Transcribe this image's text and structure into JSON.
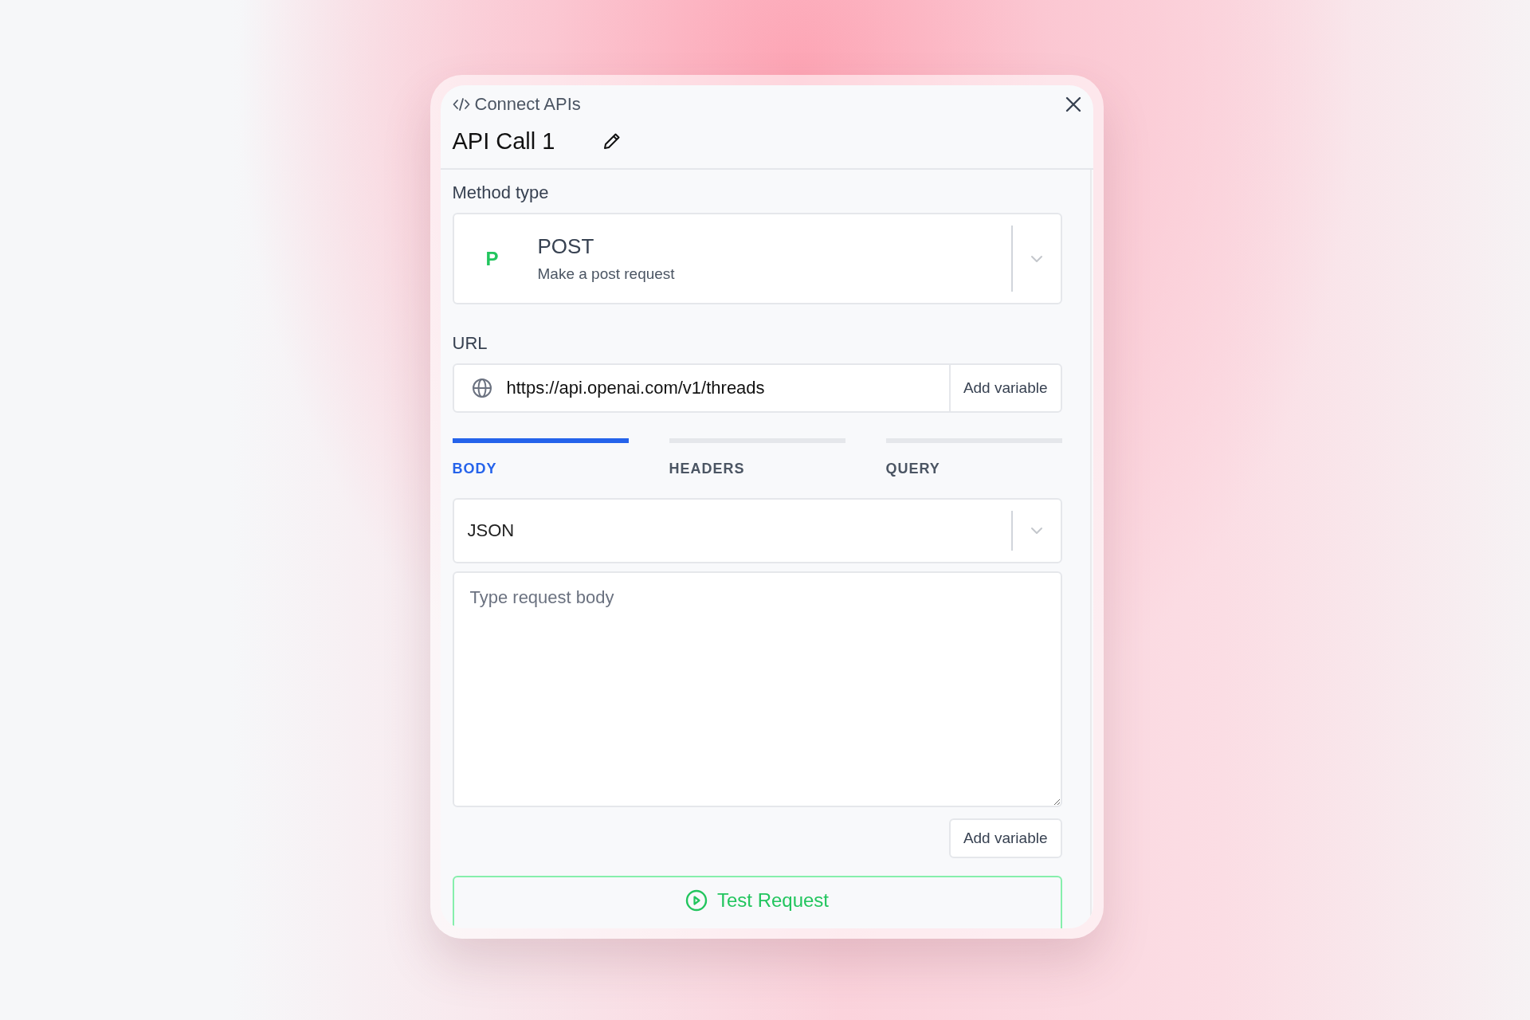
{
  "header": {
    "title": "Connect APIs",
    "name": "API Call 1"
  },
  "method": {
    "label": "Method type",
    "badge": "P",
    "name": "POST",
    "description": "Make a post request"
  },
  "url": {
    "label": "URL",
    "value": "https://api.openai.com/v1/threads",
    "button": "Add variable"
  },
  "tabs": [
    {
      "label": "BODY",
      "selected": true
    },
    {
      "label": "HEADERS",
      "selected": false
    },
    {
      "label": "QUERY",
      "selected": false
    }
  ],
  "body_type": {
    "value": "JSON"
  },
  "body": {
    "placeholder": "Type request body",
    "button": "Add variable"
  },
  "test_button": {
    "label": "Test Request"
  }
}
